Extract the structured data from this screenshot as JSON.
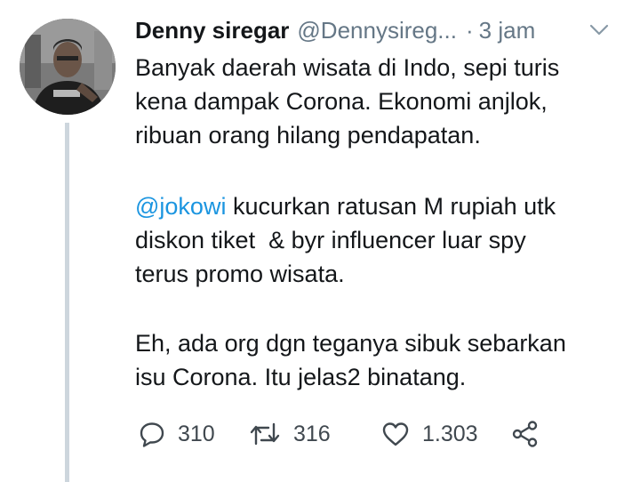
{
  "tweet": {
    "author": {
      "display_name": "Denny siregar",
      "handle": "@Dennysireg...",
      "separator": "·",
      "time": "3 jam",
      "avatar_icon": "profile-photo"
    },
    "paragraphs": [
      {
        "lines": [
          "Banyak daerah wisata di Indo, sepi turis",
          "kena dampak Corona. Ekonomi anjlok,",
          "ribuan orang hilang pendapatan."
        ]
      },
      {
        "mention": "@jokowi",
        "line1_rest": " kucurkan ratusan M rupiah utk",
        "lines": [
          "diskon tiket  & byr influencer luar spy",
          "terus promo wisata."
        ]
      },
      {
        "lines": [
          "Eh, ada org dgn teganya sibuk sebarkan",
          "isu Corona. Itu jelas2 binatang."
        ]
      }
    ],
    "actions": {
      "reply": {
        "icon": "reply-bubble-icon",
        "count": "310"
      },
      "retweet": {
        "icon": "retweet-icon",
        "count": "316"
      },
      "like": {
        "icon": "heart-icon",
        "count": "1.303"
      },
      "share": {
        "icon": "share-icon"
      }
    },
    "colors": {
      "text": "#14171a",
      "secondary": "#657786",
      "mention": "#1b95e0",
      "thread_line": "#cdd6dd"
    }
  }
}
